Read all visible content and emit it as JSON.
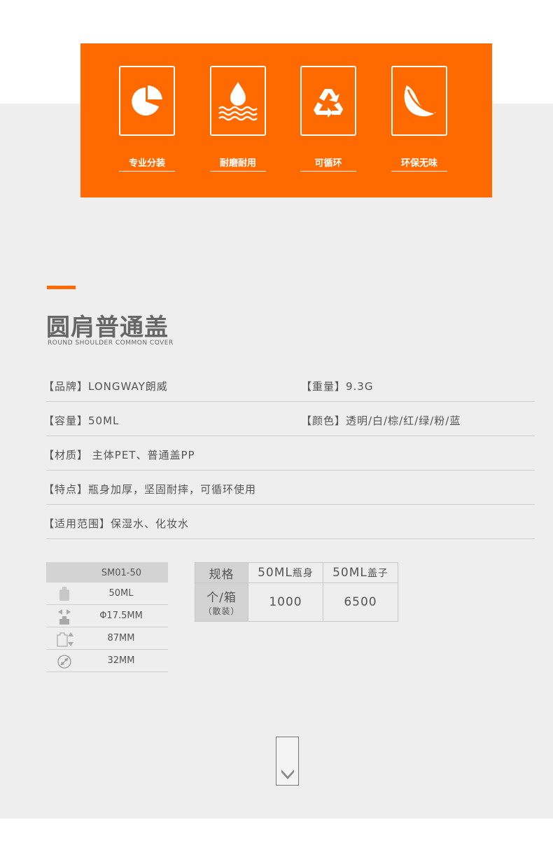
{
  "features": [
    {
      "label": "专业分装",
      "icon": "pie-chart-icon"
    },
    {
      "label": "耐磨耐用",
      "icon": "water-drop-icon"
    },
    {
      "label": "可循环",
      "icon": "recycle-icon"
    },
    {
      "label": "环保无味",
      "icon": "leaf-icon"
    }
  ],
  "product": {
    "title_cn": "圆肩普通盖",
    "title_en": "ROUND SHOULDER COMMON COVER"
  },
  "specs": {
    "brand": "【品牌】LONGWAY朗威",
    "weight": "【重量】9.3G",
    "capacity": "【容量】50ML",
    "colors": "【颜色】透明/白/棕/红/绿/粉/蓝",
    "material": "【材质】 主体PET、普通盖PP",
    "features": "【特点】瓶身加厚，坚固耐摔，可循环使用",
    "usage": "【适用范围】保湿水、化妆水"
  },
  "mini_table": {
    "model": "SM01-50",
    "rows": [
      {
        "icon": "bottle-capacity-icon",
        "value": "50ML"
      },
      {
        "icon": "diameter-icon",
        "value": "Φ17.5MM"
      },
      {
        "icon": "height-icon",
        "value": "87MM"
      },
      {
        "icon": "body-diameter-icon",
        "value": "32MM"
      }
    ]
  },
  "qty_table": {
    "spec_label": "规格",
    "col1_main": "50ML",
    "col1_sub": "瓶身",
    "col2_main": "50ML",
    "col2_sub": "盖子",
    "row_label": "个/箱",
    "row_sub": "（散装）",
    "val1": "1000",
    "val2": "6500"
  },
  "colors": {
    "accent": "#ff6a00",
    "band": "#eeeeee"
  }
}
